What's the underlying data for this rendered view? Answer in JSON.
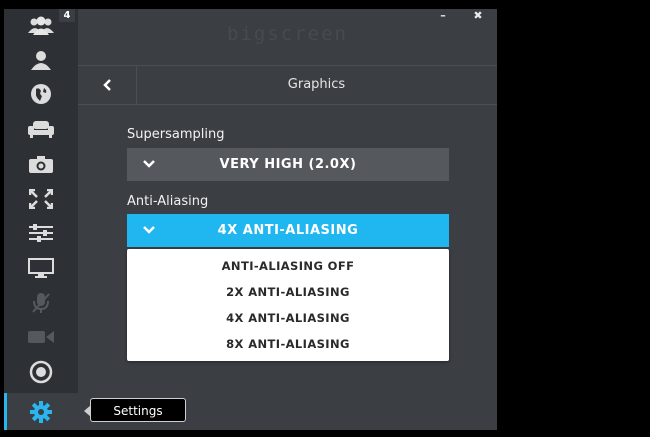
{
  "app": {
    "logo_text": "bigscreen"
  },
  "window": {
    "minimize_label": "–",
    "close_label": "✖"
  },
  "sidebar": {
    "badge": "4",
    "items": [
      {
        "icon": "group-icon"
      },
      {
        "icon": "user-icon"
      },
      {
        "icon": "globe-icon"
      },
      {
        "icon": "couch-icon"
      },
      {
        "icon": "camera-icon"
      },
      {
        "icon": "expand-icon"
      },
      {
        "icon": "sliders-icon"
      },
      {
        "icon": "monitor-icon"
      },
      {
        "icon": "mic-off-icon"
      },
      {
        "icon": "video-camera-icon"
      },
      {
        "icon": "record-icon"
      },
      {
        "icon": "gear-icon"
      }
    ],
    "active_index": 11
  },
  "header": {
    "title": "Graphics"
  },
  "supersampling": {
    "label": "Supersampling",
    "value": "VERY HIGH (2.0X)"
  },
  "anti_aliasing": {
    "label": "Anti-Aliasing",
    "value": "4X ANTI-ALIASING",
    "options": [
      "ANTI-ALIASING OFF",
      "2X ANTI-ALIASING",
      "4X ANTI-ALIASING",
      "8X ANTI-ALIASING"
    ]
  },
  "tooltip": {
    "text": "Settings"
  },
  "colors": {
    "accent": "#20b7f0",
    "sidebar_bg": "#2d3034",
    "panel_bg": "#3b3e43",
    "dropdown_gray": "#55585d"
  }
}
